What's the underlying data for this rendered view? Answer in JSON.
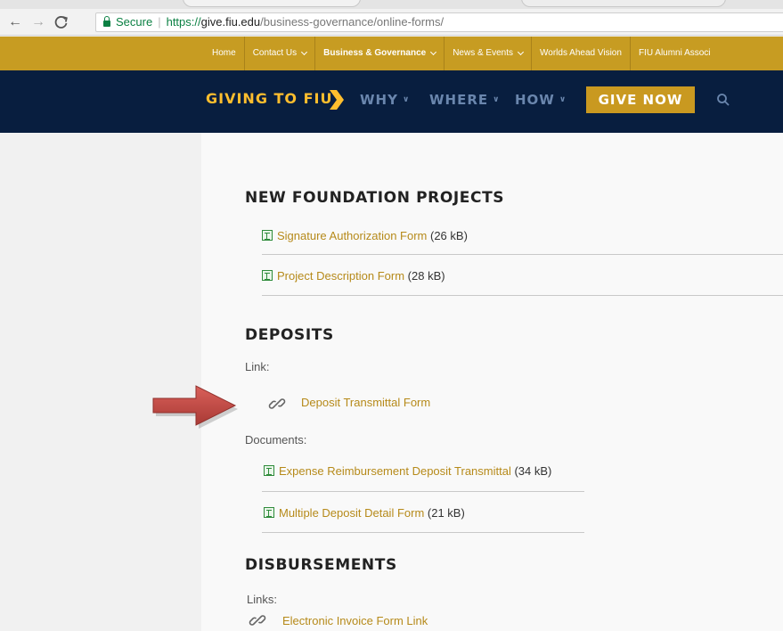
{
  "browser": {
    "back_icon": "arrow-left-icon",
    "forward_icon": "arrow-right-icon",
    "reload_icon": "reload-icon",
    "secure_label": "Secure",
    "url_protocol": "https://",
    "url_host": "give.fiu.edu",
    "url_path": "/business-governance/online-forms/"
  },
  "topnav": {
    "items": [
      {
        "label": "Home"
      },
      {
        "label": "Contact Us"
      },
      {
        "label": "Business & Governance"
      },
      {
        "label": "News & Events"
      },
      {
        "label": "Worlds Ahead Vision"
      },
      {
        "label": "FIU Alumni Associ"
      }
    ],
    "colors": {
      "background": "#c79c22",
      "text": "#ffffff"
    }
  },
  "mainnav": {
    "brand": "GIVING TO FIU",
    "items": [
      {
        "label": "WHY"
      },
      {
        "label": "WHERE"
      },
      {
        "label": "HOW"
      }
    ],
    "give_now": "GIVE NOW",
    "search_icon": "search-icon",
    "colors": {
      "background": "#081e3f",
      "brand": "#ffbe2e",
      "links": "#6a86ad",
      "button": "#c99920"
    }
  },
  "sections": {
    "new_foundation": {
      "heading": "NEW FOUNDATION PROJECTS",
      "docs": [
        {
          "name": "Signature Authorization Form",
          "size": "(26 kB)"
        },
        {
          "name": "Project Description Form",
          "size": "(28 kB)"
        }
      ]
    },
    "deposits": {
      "heading": "DEPOSITS",
      "link_label": "Link:",
      "link": "Deposit Transmittal Form",
      "documents_label": "Documents:",
      "docs": [
        {
          "name": "Expense Reimbursement Deposit Transmittal",
          "size": "(34 kB)"
        },
        {
          "name": "Multiple Deposit Detail Form",
          "size": "(21 kB)"
        }
      ]
    },
    "disbursements": {
      "heading": "DISBURSEMENTS",
      "links_label": "Links:",
      "link": "Electronic Invoice Form Link"
    }
  },
  "annotation": {
    "icon": "red-arrow-icon",
    "color": "#c0504d"
  },
  "colors": {
    "link": "#b68a1a",
    "heading": "#222222",
    "excel_icon": "#2e8b3a"
  }
}
